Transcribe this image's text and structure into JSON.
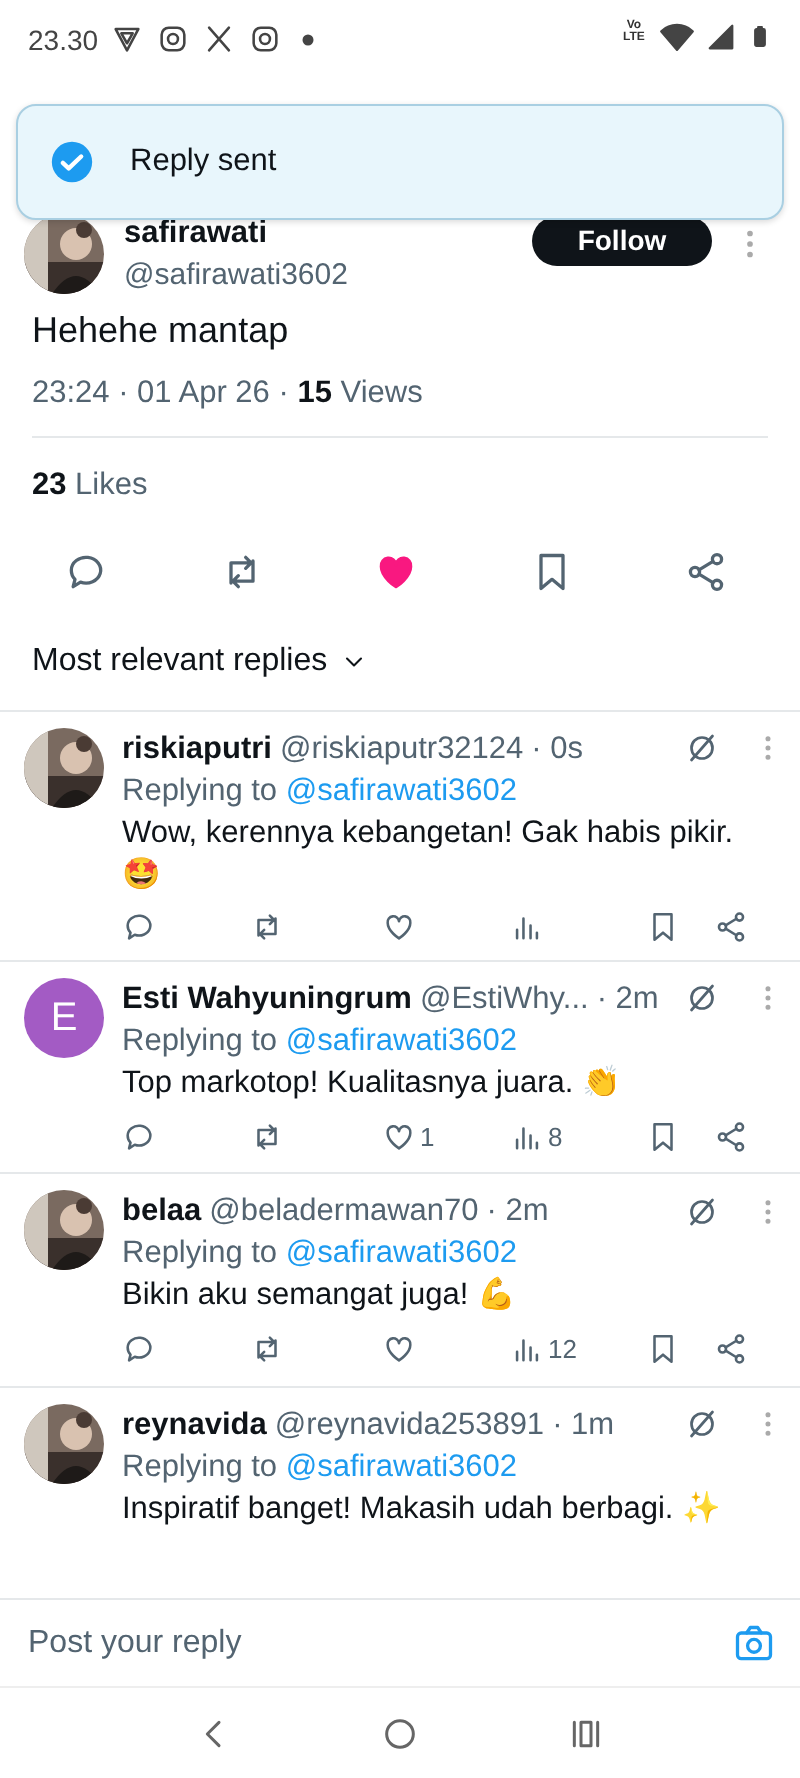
{
  "status_bar": {
    "time": "23.30",
    "network": "Vo LTE"
  },
  "toast": {
    "text": "Reply sent"
  },
  "author": {
    "name": "safirawati",
    "handle": "@safirawati3602",
    "follow": "Follow"
  },
  "post": {
    "text": "Hehehe mantap",
    "meta": "23:24 · 01 Apr 26 · **15** Views",
    "likes": "**23** Likes",
    "liked": true,
    "bookmarked": false
  },
  "sort": {
    "label": "Most relevant replies"
  },
  "replies": [
    {
      "name": "riskiaputri",
      "handle": "@riskiaputr32124",
      "time": "· 0s",
      "replying_prefix": "Replying to",
      "replying_to": "@safirawati3602",
      "text": "Wow, kerennya kebangetan! Gak habis pikir. 🤩",
      "actions": {
        "liked": false
      }
    },
    {
      "avatar": {
        "kind": "letter",
        "letter": "E",
        "color": "#a35bc4"
      },
      "name": "Esti Wahyuningrum",
      "handle": "@EstiWhy...",
      "time": "· 2m",
      "replying_prefix": "Replying to",
      "replying_to": "@safirawati3602",
      "text": "Top markotop! Kualitasnya juara. 👏",
      "actions": {
        "like_count": "1",
        "view_count": "8",
        "liked": false
      }
    },
    {
      "name": "belaa",
      "handle": "@beladermawan70",
      "time": "· 2m",
      "replying_prefix": "Replying to",
      "replying_to": "@safirawati3602",
      "text": "Bikin aku semangat juga! 💪",
      "actions": {
        "view_count": "12",
        "liked": false
      }
    },
    {
      "name": "reynavida",
      "handle": "@reynavida253891",
      "time": "· 1m",
      "replying_prefix": "Replying to",
      "replying_to": "@safirawati3602",
      "text": "Inspiratif banget! Makasih udah berbagi. ✨"
    }
  ],
  "composer": {
    "placeholder": "Post your reply"
  }
}
